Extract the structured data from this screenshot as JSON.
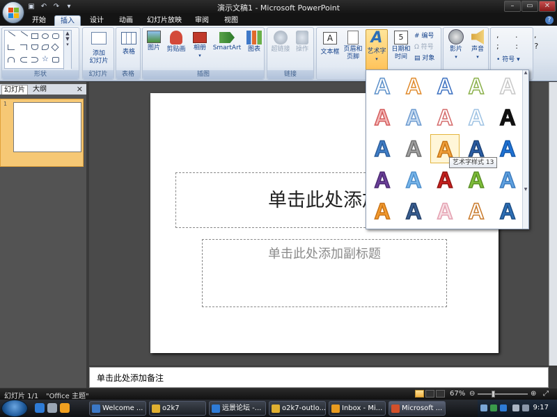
{
  "window": {
    "title": "演示文稿1 - Microsoft PowerPoint",
    "qat": [
      "save-icon",
      "undo-icon",
      "redo-icon",
      "customize-icon"
    ],
    "controls": [
      "minimize",
      "maximize",
      "close"
    ]
  },
  "ribbon_tabs": [
    "开始",
    "插入",
    "设计",
    "动画",
    "幻灯片放映",
    "审阅",
    "视图"
  ],
  "active_tab": "插入",
  "groups": {
    "shapes": {
      "label": "形状"
    },
    "slides": {
      "label": "幻灯片",
      "new_slide": "添加",
      "new_slide2": "幻灯片"
    },
    "tables": {
      "label": "表格",
      "table": "表格"
    },
    "illustrations": {
      "label": "插图",
      "picture": "图片",
      "clipart": "剪贴画",
      "album": "相册",
      "smartart": "SmartArt",
      "chart": "图表"
    },
    "links": {
      "label": "链接",
      "hyperlink": "超链接",
      "action": "操作"
    },
    "text": {
      "textbox": "文本框",
      "header_footer1": "页眉和",
      "header_footer2": "页脚",
      "wordart": "艺术字",
      "datetime1": "日期和",
      "datetime2": "时间",
      "slide_number": "编号",
      "symbol": "符号",
      "object": "对象"
    },
    "media": {
      "movie": "影片",
      "sound": "声音"
    },
    "special": {
      "symbol": "符号"
    }
  },
  "left_pane": {
    "tabs": [
      "幻灯片",
      "大纲"
    ],
    "close": "✕",
    "slide_number": "1"
  },
  "slide": {
    "title_placeholder": "单击此处添加",
    "subtitle_placeholder": "单击此处添加副标题"
  },
  "notes_placeholder": "单击此处添加备注",
  "status": {
    "slide": "幻灯片 1/1",
    "theme": "\"Office 主题\"",
    "zoom": "67%"
  },
  "wordart_gallery": {
    "tooltip": "艺术字样式 13",
    "selected_index": 12,
    "glyph": "A",
    "items": [
      {
        "fill": "#ffffff",
        "stroke": "#5b8fc9"
      },
      {
        "fill": "#ffffff",
        "stroke": "#e08a2c"
      },
      {
        "fill": "#ffffff",
        "stroke": "#3a6fc0"
      },
      {
        "fill": "#ffffff",
        "stroke": "#8ab04a"
      },
      {
        "fill": "#ffffff",
        "stroke": "#c8c8c8"
      },
      {
        "fill": "#f3b7b7",
        "stroke": "#d45b5b"
      },
      {
        "fill": "#c9ddf2",
        "stroke": "#6d9bd0"
      },
      {
        "fill": "#ffffff",
        "stroke": "#d46a6a"
      },
      {
        "fill": "#ffffff",
        "stroke": "#9fc3e3"
      },
      {
        "fill": "#111111",
        "stroke": "#111111"
      },
      {
        "fill": "#3f7ec8",
        "stroke": "#2d5e9a"
      },
      {
        "fill": "#a0a0a0",
        "stroke": "#707070"
      },
      {
        "fill": "#f2a13c",
        "stroke": "#c57414"
      },
      {
        "fill": "#2b5ea6",
        "stroke": "#1d4377"
      },
      {
        "fill": "#1f73d6",
        "stroke": "#1558a8"
      },
      {
        "fill": "#6b3f99",
        "stroke": "#4b2a72"
      },
      {
        "fill": "#78b6ea",
        "stroke": "#4e8fcb"
      },
      {
        "fill": "#c8201e",
        "stroke": "#901512"
      },
      {
        "fill": "#7fbf3a",
        "stroke": "#5a8f25"
      },
      {
        "fill": "#5fa1e0",
        "stroke": "#3c7bbd"
      },
      {
        "fill": "#f29a2e",
        "stroke": "#c97418"
      },
      {
        "fill": "#3a5f92",
        "stroke": "#24416a"
      },
      {
        "fill": "#f7dfe4",
        "stroke": "#e4a0b0"
      },
      {
        "fill": "#ffffff",
        "stroke": "#c8792a"
      },
      {
        "fill": "#2d6fb6",
        "stroke": "#1d4e85"
      }
    ]
  },
  "taskbar": {
    "tasks": [
      "Welcome ...",
      "o2k7",
      "远景论坛 -...",
      "o2k7-outlo...",
      "Inbox - Mi...",
      "Microsoft ..."
    ],
    "clock": "9:17"
  }
}
